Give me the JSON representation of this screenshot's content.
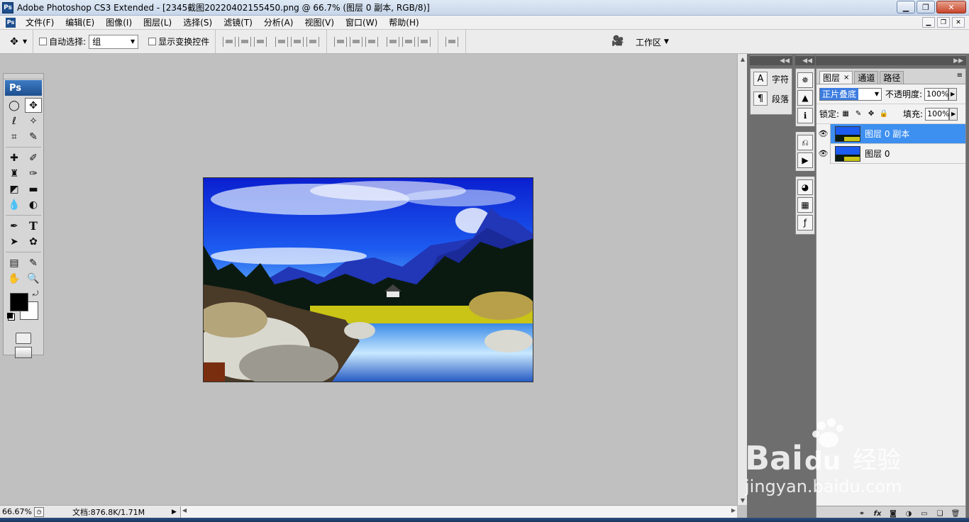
{
  "window": {
    "app_badge": "Ps",
    "title": "Adobe Photoshop CS3 Extended - [2345截图20220402155450.png @ 66.7% (图层 0 副本, RGB/8)]"
  },
  "menu": {
    "items": [
      "文件(F)",
      "编辑(E)",
      "图像(I)",
      "图层(L)",
      "选择(S)",
      "滤镜(T)",
      "分析(A)",
      "视图(V)",
      "窗口(W)",
      "帮助(H)"
    ]
  },
  "options": {
    "auto_select_label": "自动选择:",
    "auto_select_value": "组",
    "show_transform_label": "显示变换控件",
    "workspace_label": "工作区"
  },
  "toolbox": {
    "logo": "Ps",
    "type_tool": "T"
  },
  "char_panel": {
    "char_label": "字符",
    "para_label": "段落",
    "char_icon": "A",
    "para_icon": "¶"
  },
  "layers_panel": {
    "tabs": [
      "图层",
      "通道",
      "路径"
    ],
    "tab_close": "×",
    "blend_mode": "正片叠底",
    "opacity_label": "不透明度:",
    "opacity_value": "100%",
    "lock_label": "锁定:",
    "fill_label": "填充:",
    "fill_value": "100%",
    "layers": [
      {
        "name": "图层 0 副本",
        "selected": true
      },
      {
        "name": "图层 0",
        "selected": false
      }
    ],
    "footer_fx": "fx"
  },
  "status": {
    "zoom": "66.67%",
    "doc_info": "文档:876.8K/1.71M"
  },
  "watermark": {
    "brand": "Bai",
    "brand_du": "du",
    "brand_cn": "经验",
    "url": "jingyan.baidu.com"
  },
  "colors": {
    "selected_layer": "#3d8ff0",
    "dock_bg": "#6e6e6e",
    "canvas_bg": "#c0c0c0"
  }
}
